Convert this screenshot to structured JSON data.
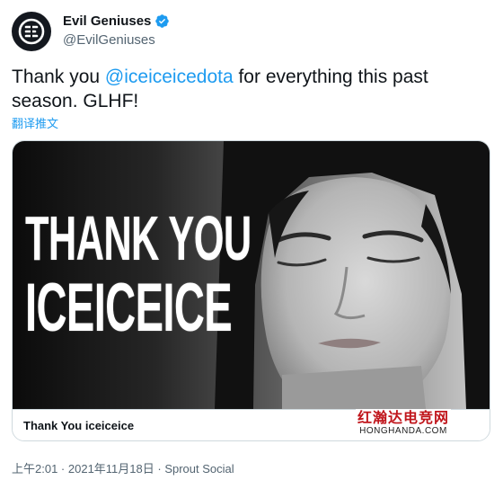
{
  "author": {
    "display_name": "Evil Geniuses",
    "handle": "@EvilGeniuses",
    "verified": true
  },
  "tweet": {
    "text_before": "Thank you ",
    "mention": "@iceiceicedota",
    "text_after": " for everything this past season. GLHF!",
    "translate_label": "翻译推文"
  },
  "card": {
    "image_headline_line1": "THANK YOU",
    "image_headline_line2": "ICEICEICE",
    "title": "Thank You iceiceice"
  },
  "watermark": {
    "chinese": "红瀚达电竞网",
    "url": "HONGHANDA.COM"
  },
  "meta": {
    "time": "上午2:01",
    "separator1": " · ",
    "date": "2021年11月18日",
    "separator2": " · ",
    "source": "Sprout Social"
  },
  "colors": {
    "link": "#1d9bf0",
    "text": "#0f1419",
    "secondary": "#536471",
    "border": "#cfd9de",
    "watermark_red": "#c0151b"
  },
  "icons": {
    "avatar": "evil-geniuses-logo",
    "verified": "verified-badge-icon"
  }
}
